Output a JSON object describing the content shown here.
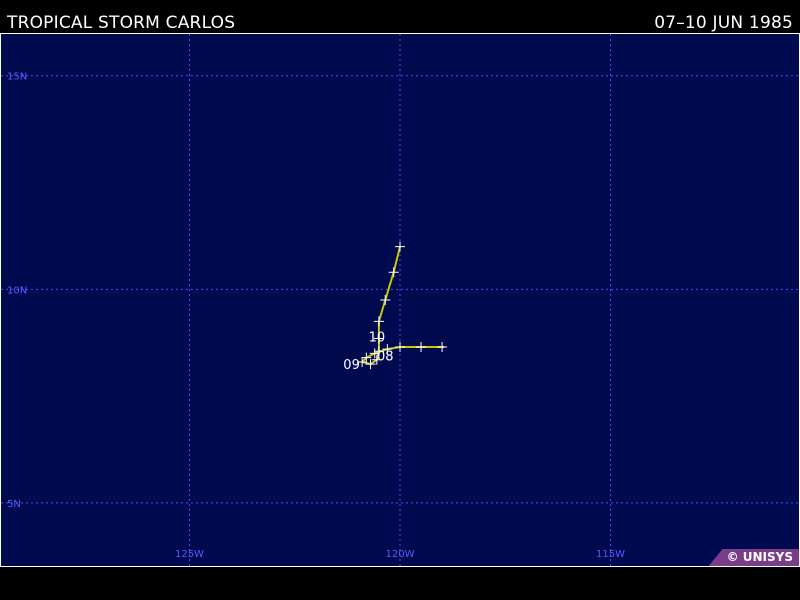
{
  "header": {
    "storm_title": "TROPICAL STORM CARLOS",
    "date_range": "07–10 JUN 1985"
  },
  "map": {
    "lat_range": [
      3.5,
      16
    ],
    "lon_range": [
      -129.5,
      -110.5
    ],
    "grid": true,
    "colors": {
      "ocean": "#000a4e",
      "grid": "#4c4cff",
      "grid_label": "#5a5aff",
      "track": "#c8c800",
      "marker": "#ffffff",
      "border": "#ffffff"
    },
    "lat_lines": [
      {
        "value": 15,
        "label": "15N"
      },
      {
        "value": 10,
        "label": "10N"
      },
      {
        "value": 5,
        "label": "5N"
      }
    ],
    "lon_lines": [
      {
        "value": -125,
        "label": "125W"
      },
      {
        "value": -120,
        "label": "120W"
      },
      {
        "value": -115,
        "label": "115W"
      }
    ]
  },
  "track": {
    "points": [
      {
        "lat": 8.65,
        "lon": -119.0
      },
      {
        "lat": 8.65,
        "lon": -119.5
      },
      {
        "lat": 8.65,
        "lon": -120.0
      },
      {
        "lat": 8.6,
        "lon": -120.3
      },
      {
        "lat": 8.5,
        "lon": -120.6
      },
      {
        "lat": 8.4,
        "lon": -120.8
      },
      {
        "lat": 8.3,
        "lon": -120.9
      },
      {
        "lat": 8.25,
        "lon": -120.7
      },
      {
        "lat": 8.35,
        "lon": -120.55
      },
      {
        "lat": 8.55,
        "lon": -120.5
      },
      {
        "lat": 8.85,
        "lon": -120.5
      },
      {
        "lat": 9.25,
        "lon": -120.5
      },
      {
        "lat": 9.75,
        "lon": -120.35
      },
      {
        "lat": 10.4,
        "lon": -120.15
      },
      {
        "lat": 11.0,
        "lon": -120.0
      }
    ],
    "end_lon": -118.95,
    "day_labels": [
      {
        "text": "08",
        "lat": 8.45,
        "lon": -120.35
      },
      {
        "text": "09",
        "lat": 8.25,
        "lon": -121.15
      },
      {
        "text": "10",
        "lat": 8.9,
        "lon": -120.55
      }
    ]
  },
  "credit": "© UNISYS"
}
